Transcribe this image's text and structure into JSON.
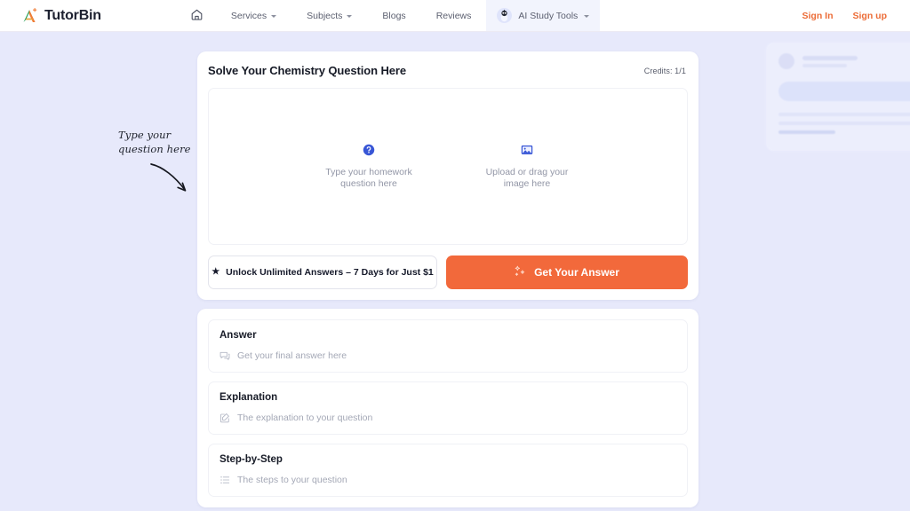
{
  "header": {
    "brand": {
      "logo_icon": "tutorbin-a-logo-icon",
      "name": "TutorBin"
    },
    "nav": [
      {
        "id": "home",
        "label": "",
        "icon": "home-icon",
        "caret": false
      },
      {
        "id": "services",
        "label": "Services",
        "icon": null,
        "caret": true
      },
      {
        "id": "subjects",
        "label": "Subjects",
        "icon": null,
        "caret": true
      },
      {
        "id": "blogs",
        "label": "Blogs",
        "icon": null,
        "caret": false
      },
      {
        "id": "reviews",
        "label": "Reviews",
        "icon": null,
        "caret": false
      },
      {
        "id": "ai-tools",
        "label": "AI Study Tools",
        "icon": "robot-avatar-icon",
        "caret": true
      }
    ],
    "auth": {
      "sign_in": "Sign In",
      "sign_up": "Sign up"
    },
    "accent_color": "#ec6c37"
  },
  "annotation": {
    "line1": "Type your",
    "line2": "question here",
    "arrow_icon": "curved-arrow-down-right-icon"
  },
  "solver": {
    "title": "Solve Your Chemistry Question Here",
    "credits": "Credits: 1/1",
    "dropzone": {
      "type_option": {
        "icon": "question-circle-icon",
        "line1": "Type your homework",
        "line2": "question here"
      },
      "upload_option": {
        "icon": "image-icon",
        "line1": "Upload or drag your",
        "line2": "image here"
      }
    },
    "unlock_button": {
      "icon": "star-icon",
      "label": "Unlock Unlimited Answers – 7 Days for Just $1"
    },
    "answer_button": {
      "icon": "sparkles-icon",
      "label": "Get Your Answer",
      "color": "#f2693b"
    }
  },
  "results": [
    {
      "title": "Answer",
      "icon": "chat-bubble-icon",
      "placeholder": "Get your final answer here"
    },
    {
      "title": "Explanation",
      "icon": "edit-square-icon",
      "placeholder": "The explanation to your question"
    },
    {
      "title": "Step-by-Step",
      "icon": "list-icon",
      "placeholder": "The steps to your question"
    }
  ],
  "theme": {
    "page_background": "#e7e9fb",
    "card_background": "#ffffff",
    "icon_blue": "#3856d6"
  }
}
